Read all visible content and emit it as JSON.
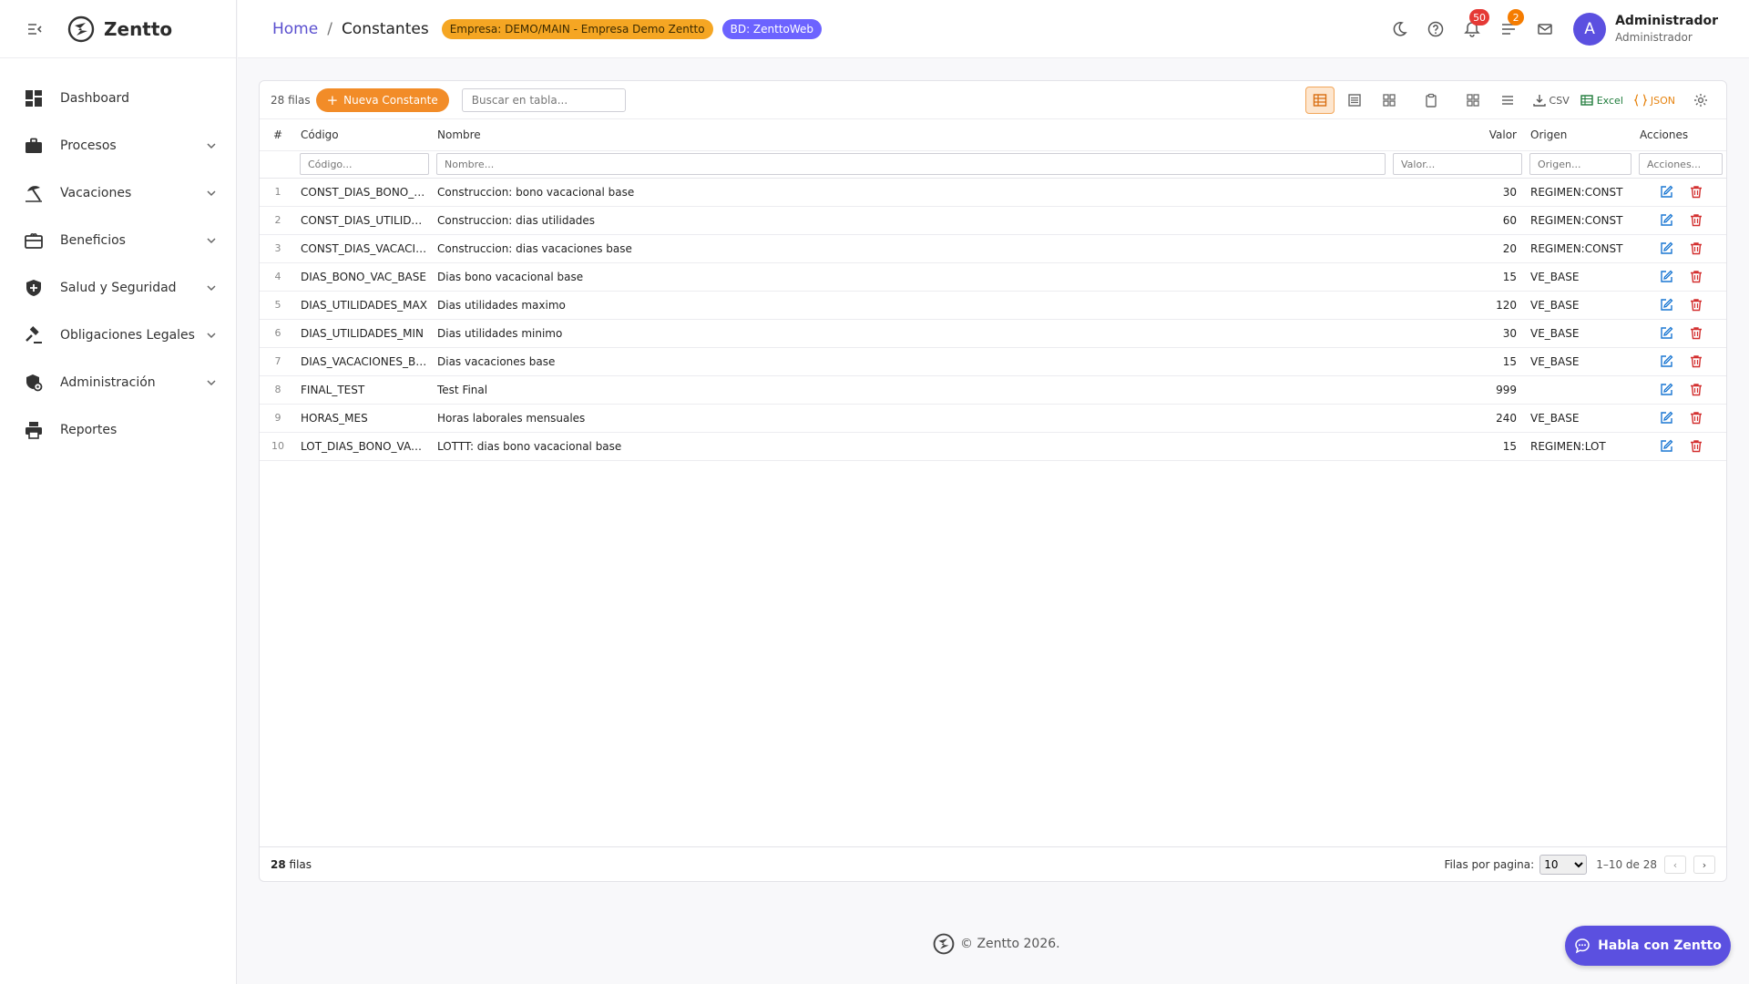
{
  "app": {
    "brand": "Zentto"
  },
  "sidebar": {
    "items": [
      {
        "label": "Dashboard",
        "icon": "dashboard-icon",
        "expandable": false
      },
      {
        "label": "Procesos",
        "icon": "briefcase-icon",
        "expandable": true
      },
      {
        "label": "Vacaciones",
        "icon": "beach-icon",
        "expandable": true
      },
      {
        "label": "Beneficios",
        "icon": "gift-card-icon",
        "expandable": true
      },
      {
        "label": "Salud y Seguridad",
        "icon": "shield-icon",
        "expandable": true
      },
      {
        "label": "Obligaciones Legales",
        "icon": "gavel-icon",
        "expandable": true
      },
      {
        "label": "Administración",
        "icon": "admin-icon",
        "expandable": true
      },
      {
        "label": "Reportes",
        "icon": "printer-icon",
        "expandable": false
      }
    ]
  },
  "header": {
    "breadcrumb_home": "Home",
    "breadcrumb_sep": "/",
    "page_title": "Constantes",
    "chip_empresa": "Empresa: DEMO/MAIN - Empresa Demo Zentto",
    "chip_bd": "BD: ZenttoWeb",
    "notifications_count": "50",
    "tasks_count": "2",
    "avatar_letter": "A",
    "user_name": "Administrador",
    "user_role": "Administrador"
  },
  "toolbar": {
    "row_count": "28 filas",
    "new_button": "Nueva Constante",
    "search_placeholder": "Buscar en tabla...",
    "csv_label": "CSV",
    "excel_label": "Excel",
    "json_label": "JSON"
  },
  "table": {
    "columns": {
      "idx": "#",
      "codigo": "Código",
      "nombre": "Nombre",
      "valor": "Valor",
      "origen": "Origen",
      "acciones": "Acciones"
    },
    "filters": {
      "codigo": "Código...",
      "nombre": "Nombre...",
      "valor": "Valor...",
      "origen": "Origen...",
      "acciones": "Acciones..."
    },
    "rows": [
      {
        "n": "1",
        "codigo": "CONST_DIAS_BONO_V...",
        "nombre": "Construccion: bono vacacional base",
        "valor": "30",
        "origen": "REGIMEN:CONST"
      },
      {
        "n": "2",
        "codigo": "CONST_DIAS_UTILIDAD...",
        "nombre": "Construccion: dias utilidades",
        "valor": "60",
        "origen": "REGIMEN:CONST"
      },
      {
        "n": "3",
        "codigo": "CONST_DIAS_VACACIO...",
        "nombre": "Construccion: dias vacaciones base",
        "valor": "20",
        "origen": "REGIMEN:CONST"
      },
      {
        "n": "4",
        "codigo": "DIAS_BONO_VAC_BASE",
        "nombre": "Dias bono vacacional base",
        "valor": "15",
        "origen": "VE_BASE"
      },
      {
        "n": "5",
        "codigo": "DIAS_UTILIDADES_MAX",
        "nombre": "Dias utilidades maximo",
        "valor": "120",
        "origen": "VE_BASE"
      },
      {
        "n": "6",
        "codigo": "DIAS_UTILIDADES_MIN",
        "nombre": "Dias utilidades minimo",
        "valor": "30",
        "origen": "VE_BASE"
      },
      {
        "n": "7",
        "codigo": "DIAS_VACACIONES_BASE",
        "nombre": "Dias vacaciones base",
        "valor": "15",
        "origen": "VE_BASE"
      },
      {
        "n": "8",
        "codigo": "FINAL_TEST",
        "nombre": "Test Final",
        "valor": "999",
        "origen": ""
      },
      {
        "n": "9",
        "codigo": "HORAS_MES",
        "nombre": "Horas laborales mensuales",
        "valor": "240",
        "origen": "VE_BASE"
      },
      {
        "n": "10",
        "codigo": "LOT_DIAS_BONO_VAC_...",
        "nombre": "LOTTT: dias bono vacacional base",
        "valor": "15",
        "origen": "REGIMEN:LOT"
      }
    ]
  },
  "footer": {
    "count_num": "28",
    "count_word": "filas",
    "rows_per_page_label": "Filas por pagina:",
    "rows_per_page_value": "10",
    "range": "1–10 de 28",
    "prev": "‹",
    "next": "›"
  },
  "copyright": "© Zentto 2026.",
  "chat_button": "Habla con Zentto",
  "colors": {
    "accent": "#5b50e0",
    "orange": "#f28c28",
    "edit": "#1976d2",
    "delete": "#d32f2f"
  }
}
